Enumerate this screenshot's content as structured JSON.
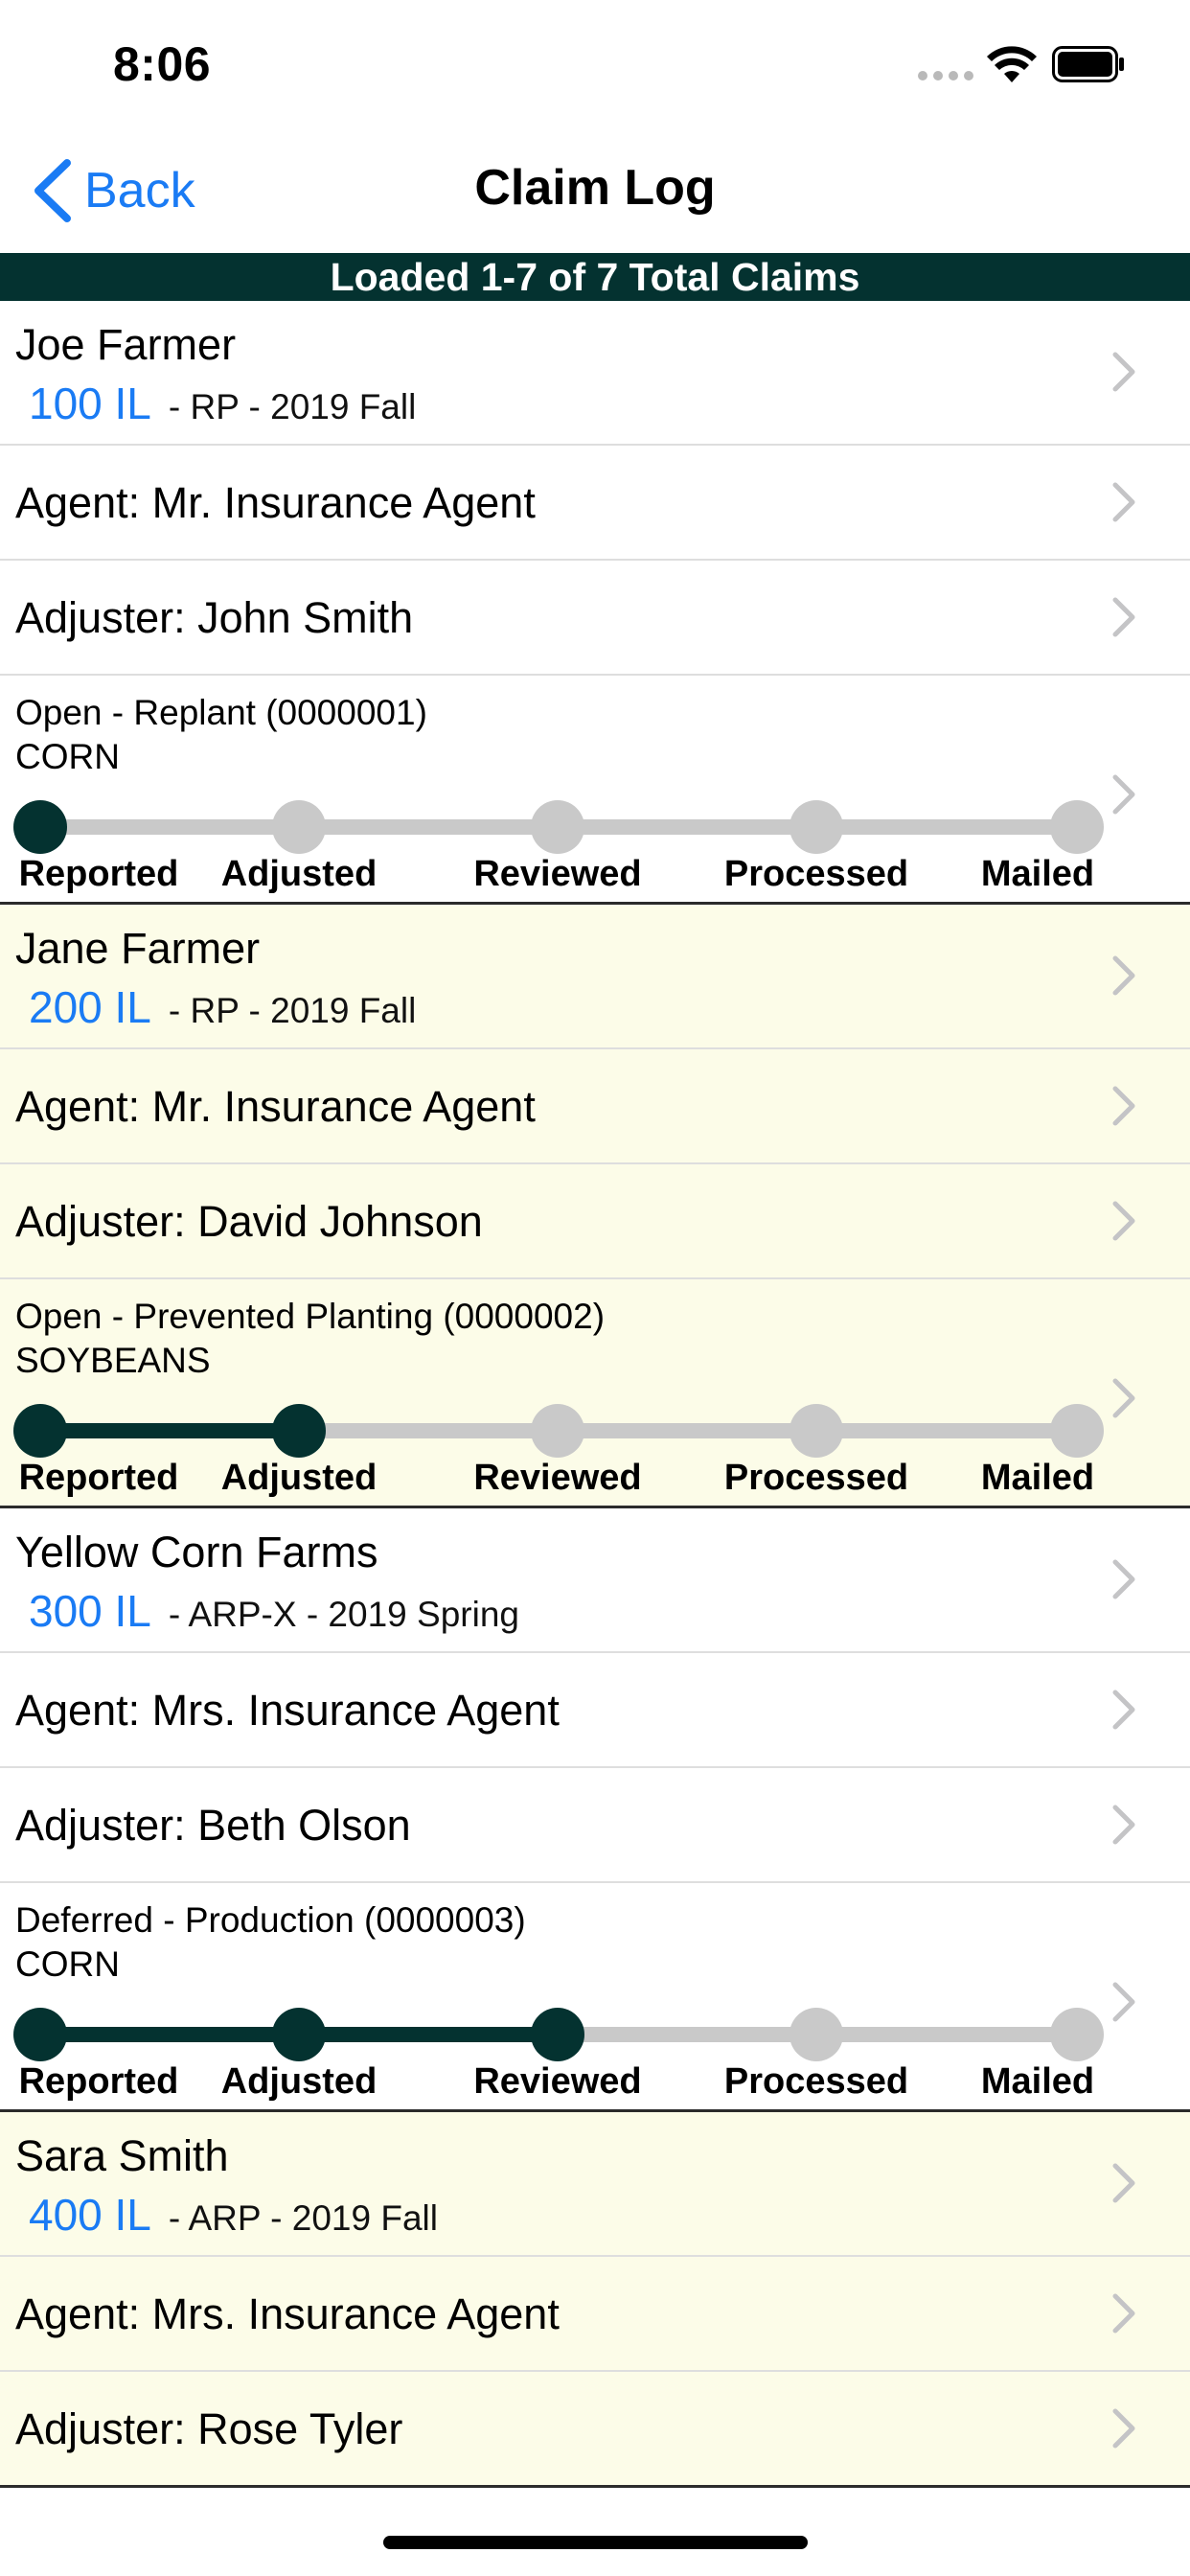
{
  "status_bar": {
    "time": "8:06"
  },
  "nav": {
    "back_label": "Back",
    "title": "Claim Log"
  },
  "banner": "Loaded 1-7 of 7 Total Claims",
  "colors": {
    "accent": "#1a7bf4",
    "brand_dark": "#043230",
    "alt_row": "#fcfce8"
  },
  "steps": [
    "Reported",
    "Adjusted",
    "Reviewed",
    "Processed",
    "Mailed"
  ],
  "claims": [
    {
      "name": "Joe Farmer",
      "policy_code": "100 IL",
      "policy_detail": "- RP - 2019 Fall",
      "agent": "Agent: Mr. Insurance Agent",
      "adjuster": "Adjuster: John Smith",
      "status": "Open - Replant (0000001)",
      "crop": "CORN",
      "completed_steps": 1
    },
    {
      "name": "Jane Farmer",
      "policy_code": "200 IL",
      "policy_detail": "- RP - 2019 Fall",
      "agent": "Agent: Mr. Insurance Agent",
      "adjuster": "Adjuster: David Johnson",
      "status": "Open - Prevented Planting (0000002)",
      "crop": "SOYBEANS",
      "completed_steps": 2
    },
    {
      "name": "Yellow Corn Farms",
      "policy_code": "300 IL",
      "policy_detail": "- ARP-X - 2019 Spring",
      "agent": "Agent: Mrs. Insurance Agent",
      "adjuster": "Adjuster: Beth Olson",
      "status": "Deferred - Production (0000003)",
      "crop": "CORN",
      "completed_steps": 3
    },
    {
      "name": "Sara Smith",
      "policy_code": "400 IL",
      "policy_detail": "- ARP - 2019 Fall",
      "agent": "Agent: Mrs. Insurance Agent",
      "adjuster": "Adjuster: Rose Tyler"
    }
  ]
}
